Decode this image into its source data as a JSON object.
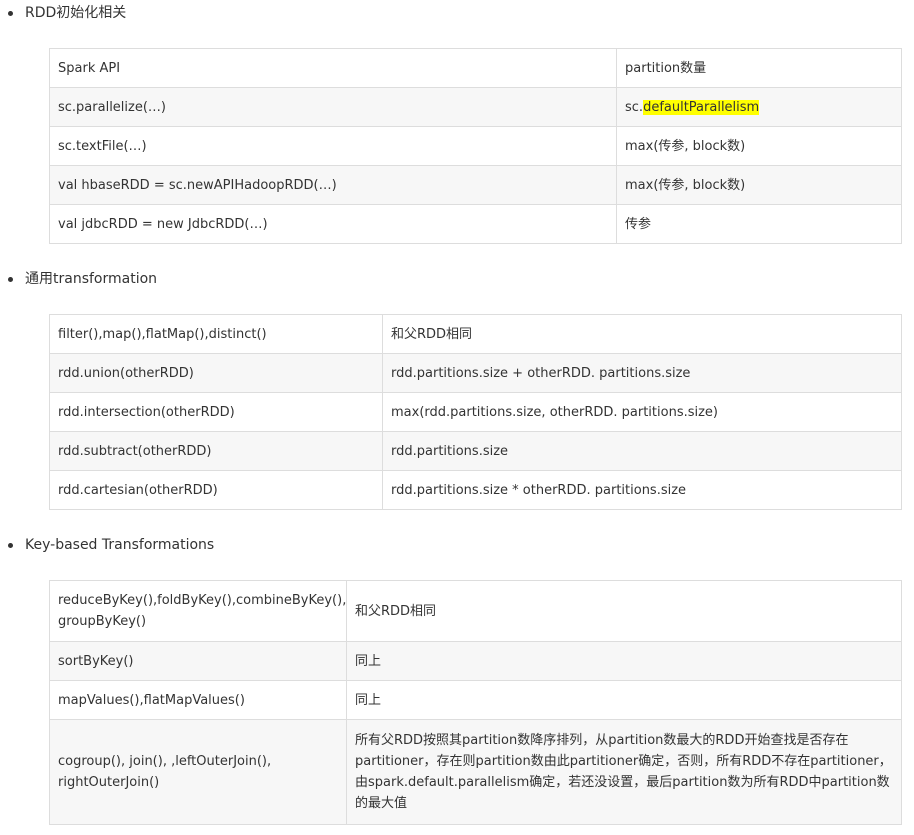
{
  "sections": [
    {
      "title": "RDD初始化相关",
      "rows": [
        [
          "Spark API",
          "partition数量"
        ],
        [
          "sc.parallelize(…)",
          "sc.defaultParallelism"
        ],
        [
          "sc.textFile(…)",
          "max(传参, block数)"
        ],
        [
          "val hbaseRDD = sc.newAPIHadoopRDD(…)",
          "max(传参, block数)"
        ],
        [
          "val jdbcRDD = new JdbcRDD(…)",
          "传参"
        ]
      ]
    },
    {
      "title": "通用transformation",
      "rows": [
        [
          "filter(),map(),flatMap(),distinct()",
          "和父RDD相同"
        ],
        [
          "rdd.union(otherRDD)",
          "rdd.partitions.size + otherRDD. partitions.size"
        ],
        [
          "rdd.intersection(otherRDD)",
          "max(rdd.partitions.size, otherRDD. partitions.size)"
        ],
        [
          "rdd.subtract(otherRDD)",
          "rdd.partitions.size"
        ],
        [
          "rdd.cartesian(otherRDD)",
          "rdd.partitions.size * otherRDD. partitions.size"
        ]
      ]
    },
    {
      "title": "Key-based Transformations",
      "rows": [
        [
          "reduceByKey(),foldByKey(),combineByKey(), groupByKey()",
          "和父RDD相同"
        ],
        [
          "sortByKey()",
          "同上"
        ],
        [
          "mapValues(),flatMapValues()",
          "同上"
        ],
        [
          "cogroup(), join(), ,leftOuterJoin(), rightOuterJoin()",
          "所有父RDD按照其partition数降序排列，从partition数最大的RDD开始查找是否存在partitioner，存在则partition数由此partitioner确定，否则，所有RDD不存在partitioner，由spark.default.parallelism确定，若还没设置，最后partition数为所有RDD中partition数的最大值"
        ]
      ]
    }
  ],
  "highlight": {
    "prefix": "sc.",
    "marked": "defaultParallelism",
    "color": "#ffff00"
  }
}
